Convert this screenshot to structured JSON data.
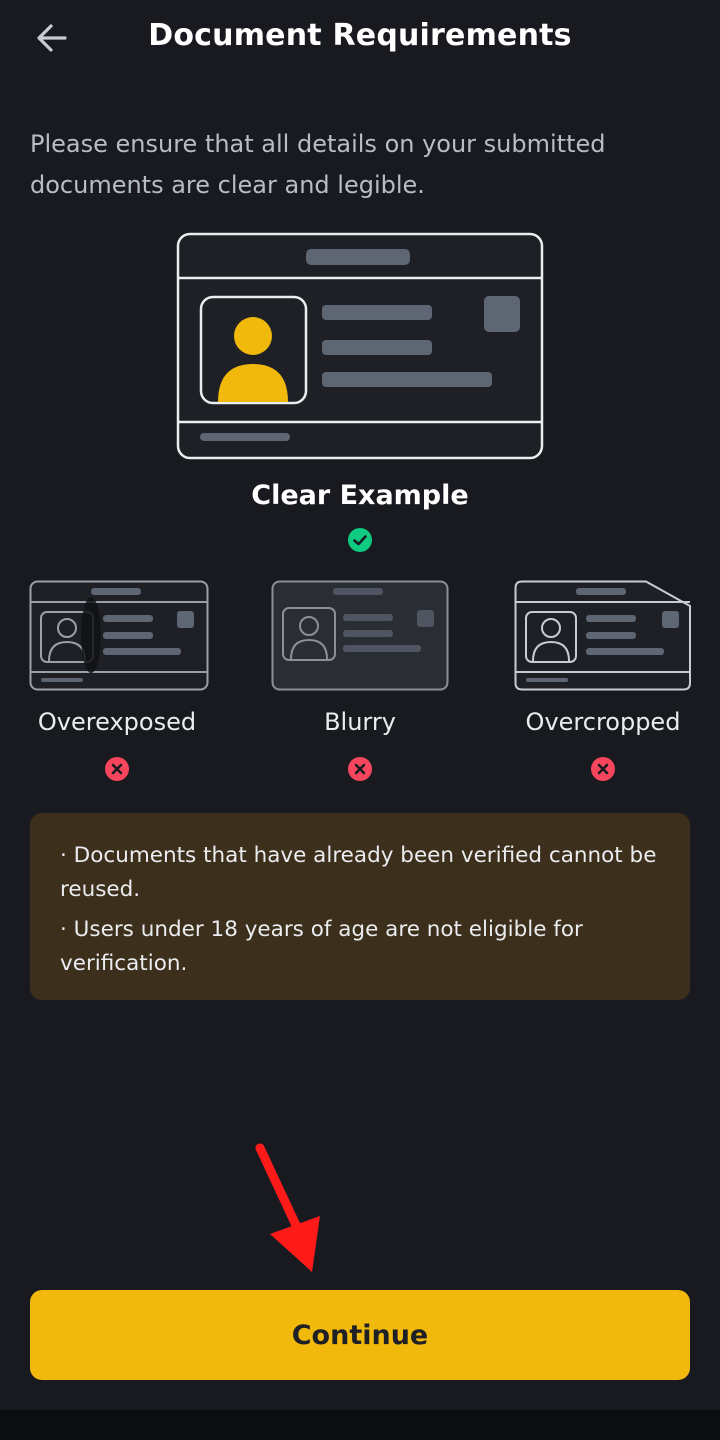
{
  "header": {
    "title": "Document Requirements",
    "back_icon": "arrow-left-icon"
  },
  "intro": {
    "text": "Please ensure that all details on your submitted documents are clear and legible."
  },
  "clear_example": {
    "label": "Clear Example",
    "status_icon": "check-circle-icon",
    "status_color": "#0ecb81"
  },
  "bad_examples": [
    {
      "label": "Overexposed",
      "status_icon": "x-circle-icon"
    },
    {
      "label": "Blurry",
      "status_icon": "x-circle-icon"
    },
    {
      "label": "Overcropped",
      "status_icon": "x-circle-icon"
    }
  ],
  "notice": {
    "items": [
      "· Documents that have already been verified cannot be reused.",
      "· Users under 18 years of age are not eligible for verification."
    ]
  },
  "colors": {
    "accent": "#f0b90b",
    "error": "#f6465d",
    "success": "#0ecb81",
    "background": "#181a20",
    "notice_bg": "#3c2f1b"
  },
  "footer": {
    "continue_label": "Continue"
  }
}
